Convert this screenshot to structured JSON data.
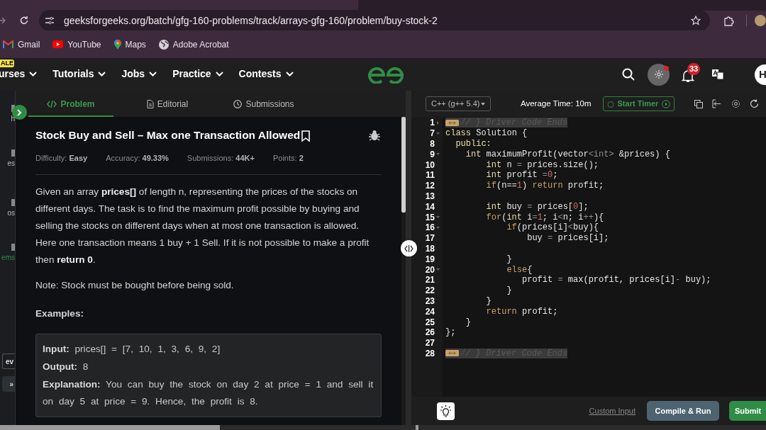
{
  "browser": {
    "url": "geeksforgeeks.org/batch/gfg-160-problems/track/arrays-gfg-160/problem/buy-stock-2",
    "bookmarks": [
      {
        "label": "Gmail",
        "kind": "mail"
      },
      {
        "label": "YouTube",
        "kind": "video"
      },
      {
        "label": "Maps",
        "kind": "pin"
      },
      {
        "label": "Adobe Acrobat",
        "kind": "globe"
      }
    ]
  },
  "navbar": {
    "badge": "ALE",
    "items": [
      "urses",
      "Tutorials",
      "Jobs",
      "Practice",
      "Contests"
    ],
    "notification_count": "33",
    "theme_dot": true,
    "avatar": "H"
  },
  "sidebar": {
    "items": [
      {
        "label": "h",
        "selected": false
      },
      {
        "label": "es",
        "selected": false
      },
      {
        "label": "os",
        "selected": false
      },
      {
        "label": "ems",
        "selected": true
      }
    ],
    "buttons": [
      "ev",
      "»"
    ]
  },
  "tabs": [
    {
      "label": "Problem",
      "kind": "code",
      "selected": true
    },
    {
      "label": "Editorial",
      "kind": "doc",
      "selected": false
    },
    {
      "label": "Submissions",
      "kind": "clock",
      "selected": false
    }
  ],
  "problem": {
    "title": "Stock Buy and Sell – Max one Transaction Allowed",
    "meta": [
      {
        "label": "Difficulty:",
        "value": "Easy"
      },
      {
        "label": "Accuracy:",
        "value": "49.33%"
      },
      {
        "label": "Submissions:",
        "value": "44K+"
      },
      {
        "label": "Points:",
        "value": "2"
      }
    ],
    "description": "Given an array **prices[]** of length n, representing the prices of the stocks on different days. The task is to find the maximum profit possible by buying and selling the stocks on different days when at most one transaction is allowed. Here one transaction means 1 buy + 1 Sell. If it is not possible to make a profit then **return 0**.",
    "note": "Note: Stock must be bought before being sold.",
    "examples_heading": "Examples:",
    "example": [
      {
        "label": "Input:",
        "value": "prices[] = [7, 10, 1, 3, 6, 9, 2]"
      },
      {
        "label": "Output:",
        "value": "8"
      },
      {
        "label": "Explanation:",
        "value": "You can buy the stock on day 2 at price = 1 and sell it on day 5 at price = 9. Hence, the profit is 8."
      }
    ]
  },
  "editor": {
    "language": "C++ (g++ 5.4)",
    "average_time": "Average Time: 10m",
    "timer_button": "Start Timer",
    "lines": [
      {
        "number": "1",
        "foldable": true,
        "collapsed": true,
        "kind": "folded",
        "code": [
          {
            "text": "// } Driver Code Ends",
            "kind": "comment"
          }
        ]
      },
      {
        "number": "7",
        "foldable": true,
        "collapsed": false,
        "kind": "code",
        "code": [
          {
            "text": "class",
            "kind": "type"
          },
          {
            "text": " Solution {",
            "kind": "plain"
          }
        ]
      },
      {
        "number": "8",
        "foldable": false,
        "kind": "code",
        "code": [
          {
            "text": "  public:",
            "kind": "type"
          }
        ]
      },
      {
        "number": "9",
        "foldable": true,
        "collapsed": false,
        "kind": "code",
        "code": [
          {
            "text": "    int",
            "kind": "type"
          },
          {
            "text": " maximumProfit(vector",
            "kind": "plain"
          },
          {
            "text": "<int>",
            "kind": "op"
          },
          {
            "text": " &prices) {",
            "kind": "plain"
          }
        ]
      },
      {
        "number": "10",
        "foldable": false,
        "kind": "code",
        "code": [
          {
            "text": "        int",
            "kind": "type"
          },
          {
            "text": " n ",
            "kind": "plain"
          },
          {
            "text": "=",
            "kind": "op"
          },
          {
            "text": " prices.size();",
            "kind": "plain"
          }
        ]
      },
      {
        "number": "11",
        "foldable": false,
        "kind": "code",
        "code": [
          {
            "text": "        int",
            "kind": "type"
          },
          {
            "text": " profit ",
            "kind": "plain"
          },
          {
            "text": "=",
            "kind": "op"
          },
          {
            "text": "0",
            "kind": "number"
          },
          {
            "text": ";",
            "kind": "plain"
          }
        ]
      },
      {
        "number": "12",
        "foldable": false,
        "kind": "code",
        "code": [
          {
            "text": "        if",
            "kind": "keyword"
          },
          {
            "text": "(n==",
            "kind": "plain"
          },
          {
            "text": "1",
            "kind": "number"
          },
          {
            "text": ") ",
            "kind": "plain"
          },
          {
            "text": "return",
            "kind": "keyword"
          },
          {
            "text": " profit;",
            "kind": "plain"
          }
        ]
      },
      {
        "number": "13",
        "foldable": false,
        "kind": "code"
      },
      {
        "number": "14",
        "foldable": false,
        "kind": "code",
        "code": [
          {
            "text": "        int",
            "kind": "type"
          },
          {
            "text": " buy ",
            "kind": "plain"
          },
          {
            "text": "=",
            "kind": "op"
          },
          {
            "text": " prices[",
            "kind": "plain"
          },
          {
            "text": "0",
            "kind": "number"
          },
          {
            "text": "];",
            "kind": "plain"
          }
        ]
      },
      {
        "number": "15",
        "foldable": true,
        "collapsed": false,
        "kind": "code",
        "code": [
          {
            "text": "        for",
            "kind": "keyword"
          },
          {
            "text": "(",
            "kind": "plain"
          },
          {
            "text": "int",
            "kind": "type"
          },
          {
            "text": " i",
            "kind": "plain"
          },
          {
            "text": "=",
            "kind": "op"
          },
          {
            "text": "1",
            "kind": "number"
          },
          {
            "text": "; i",
            "kind": "plain"
          },
          {
            "text": "<",
            "kind": "op"
          },
          {
            "text": "n; i",
            "kind": "plain"
          },
          {
            "text": "++",
            "kind": "op"
          },
          {
            "text": "){",
            "kind": "plain"
          }
        ]
      },
      {
        "number": "16",
        "foldable": true,
        "collapsed": false,
        "kind": "code",
        "code": [
          {
            "text": "            if",
            "kind": "keyword"
          },
          {
            "text": "(prices[i]",
            "kind": "plain"
          },
          {
            "text": "<",
            "kind": "op"
          },
          {
            "text": "buy){",
            "kind": "plain"
          }
        ]
      },
      {
        "number": "17",
        "foldable": false,
        "kind": "code",
        "code": [
          {
            "text": "                buy ",
            "kind": "plain"
          },
          {
            "text": "=",
            "kind": "op"
          },
          {
            "text": " prices[i];",
            "kind": "plain"
          }
        ]
      },
      {
        "number": "18",
        "foldable": false,
        "kind": "code"
      },
      {
        "number": "19",
        "foldable": false,
        "kind": "code",
        "code": [
          {
            "text": "            }",
            "kind": "plain"
          }
        ]
      },
      {
        "number": "20",
        "foldable": true,
        "collapsed": false,
        "kind": "code",
        "code": [
          {
            "text": "            else",
            "kind": "keyword"
          },
          {
            "text": "{",
            "kind": "plain"
          }
        ]
      },
      {
        "number": "21",
        "foldable": false,
        "kind": "code",
        "code": [
          {
            "text": "               profit ",
            "kind": "plain"
          },
          {
            "text": "=",
            "kind": "op"
          },
          {
            "text": " max(profit, prices[i]",
            "kind": "plain"
          },
          {
            "text": "-",
            "kind": "op"
          },
          {
            "text": " buy);",
            "kind": "plain"
          }
        ]
      },
      {
        "number": "22",
        "foldable": false,
        "kind": "code",
        "code": [
          {
            "text": "            }",
            "kind": "plain"
          }
        ]
      },
      {
        "number": "23",
        "foldable": false,
        "kind": "code",
        "code": [
          {
            "text": "        }",
            "kind": "plain"
          }
        ]
      },
      {
        "number": "24",
        "foldable": false,
        "kind": "code",
        "code": [
          {
            "text": "        return",
            "kind": "keyword"
          },
          {
            "text": " profit;",
            "kind": "plain"
          }
        ]
      },
      {
        "number": "25",
        "foldable": false,
        "kind": "code",
        "code": [
          {
            "text": "    }",
            "kind": "plain"
          }
        ]
      },
      {
        "number": "26",
        "foldable": false,
        "kind": "code",
        "code": [
          {
            "text": "};",
            "kind": "plain"
          }
        ]
      },
      {
        "number": "27",
        "foldable": false,
        "kind": "code"
      },
      {
        "number": "28",
        "foldable": false,
        "kind": "folded",
        "code": [
          {
            "text": "// } Driver Code Ends",
            "kind": "comment"
          }
        ]
      }
    ],
    "custom_input": "Custom Input",
    "compile_button": "Compile & Run",
    "submit_button": "Submit"
  }
}
